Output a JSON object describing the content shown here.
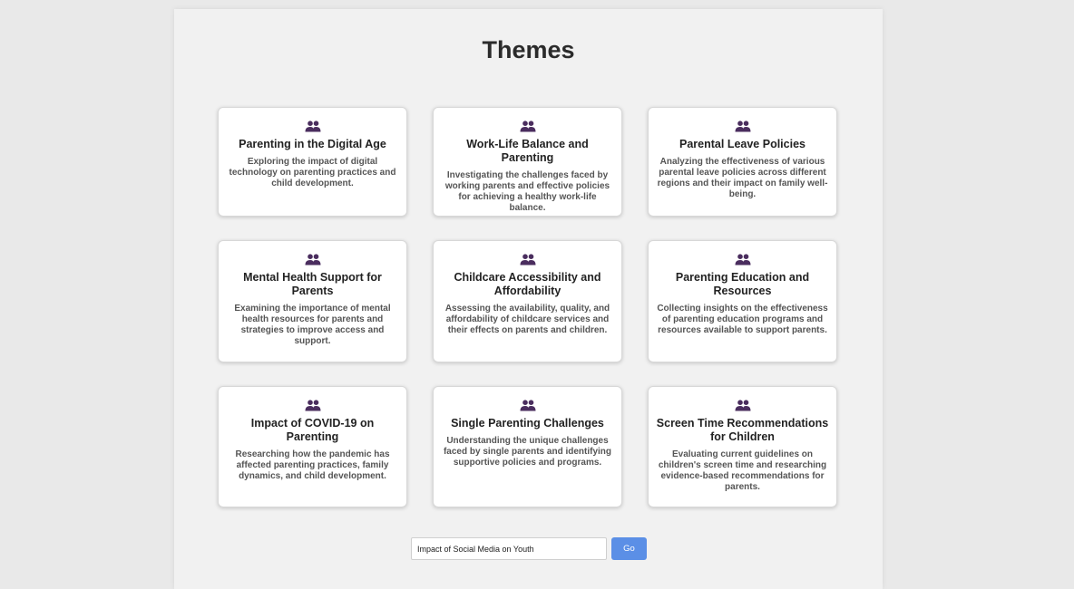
{
  "page": {
    "title": "Themes"
  },
  "colors": {
    "icon": "#4a2d5e",
    "button": "#5b8fe6"
  },
  "themes": [
    {
      "title": "Parenting in the Digital Age",
      "description": "Exploring the impact of digital technology on parenting practices and child development.",
      "icon": "users-icon"
    },
    {
      "title": "Work-Life Balance and Parenting",
      "description": "Investigating the challenges faced by working parents and effective policies for achieving a healthy work-life balance.",
      "icon": "users-icon"
    },
    {
      "title": "Parental Leave Policies",
      "description": "Analyzing the effectiveness of various parental leave policies across different regions and their impact on family well-being.",
      "icon": "users-icon"
    },
    {
      "title": "Mental Health Support for Parents",
      "description": "Examining the importance of mental health resources for parents and strategies to improve access and support.",
      "icon": "users-icon"
    },
    {
      "title": "Childcare Accessibility and Affordability",
      "description": "Assessing the availability, quality, and affordability of childcare services and their effects on parents and children.",
      "icon": "users-icon"
    },
    {
      "title": "Parenting Education and Resources",
      "description": "Collecting insights on the effectiveness of parenting education programs and resources available to support parents.",
      "icon": "users-icon"
    },
    {
      "title": "Impact of COVID-19 on Parenting",
      "description": "Researching how the pandemic has affected parenting practices, family dynamics, and child development.",
      "icon": "users-icon"
    },
    {
      "title": "Single Parenting Challenges",
      "description": "Understanding the unique challenges faced by single parents and identifying supportive policies and programs.",
      "icon": "users-icon"
    },
    {
      "title": "Screen Time Recommendations for Children",
      "description": "Evaluating current guidelines on children's screen time and researching evidence-based recommendations for parents.",
      "icon": "users-icon"
    }
  ],
  "search": {
    "value": "Impact of Social Media on Youth",
    "placeholder": ""
  },
  "go_button": {
    "label": "Go"
  }
}
